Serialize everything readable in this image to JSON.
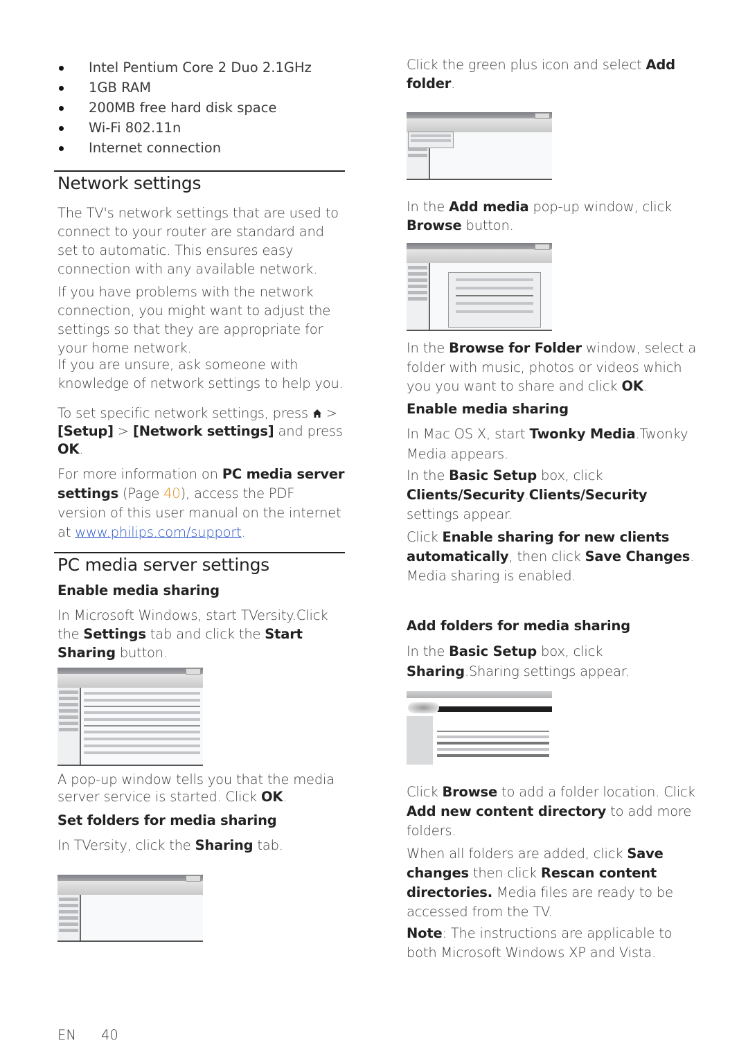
{
  "requirements": {
    "items": [
      "Intel Pentium Core 2 Duo 2.1GHz",
      "1GB RAM",
      "200MB free hard disk space",
      "Wi-Fi 802.11n",
      "Internet connection"
    ]
  },
  "network": {
    "title": "Network settings",
    "para1": "The TV's network settings that are used to connect to your router are standard and set to automatic. This ensures easy connection with any available network.",
    "para2": "If you have problems with the network connection, you might want to adjust the settings so that they are appropriate for your home network.",
    "para3": "If you are unsure, ask someone with knowledge of network settings to help you.",
    "para4_a": "To set specific network settings, press ",
    "para4_b": " > ",
    "para4_setup": "[Setup]",
    "para4_c": " > ",
    "para4_netset": "[Network settings]",
    "para4_d": " and press ",
    "para4_ok": "OK",
    "para4_e": ".",
    "para5_a": "For more information on ",
    "para5_bold": "PC media server settings",
    "para5_b": " (Page ",
    "para5_page": "40",
    "para5_c": "), access the PDF version of this user manual on the internet at ",
    "para5_link": "www.philips.com/support",
    "para5_d": "."
  },
  "pcms": {
    "title": "PC media server settings",
    "enable_heading": "Enable media sharing",
    "win_a": "In Microsoft Windows, start TVersity.Click the ",
    "win_settings": "Settings",
    "win_b": " tab and click the ",
    "win_start": "Start Sharing",
    "win_c": " button.",
    "popup_a": "A pop-up window tells you that the media server service is started. Click ",
    "popup_ok": "OK",
    "popup_b": ".",
    "set_folders_heading": "Set folders for media sharing",
    "tversity_a": "In TVersity, click the ",
    "tversity_sharing": "Sharing",
    "tversity_b": " tab."
  },
  "right": {
    "plus_a": "Click the green plus icon and select ",
    "plus_bold": "Add folder",
    "plus_b": ".",
    "addmedia_a": "In the ",
    "addmedia_bold": "Add media",
    "addmedia_b": " pop-up window, click ",
    "addmedia_browse": "Browse",
    "addmedia_c": " button.",
    "bff_a": "In the ",
    "bff_bold": "Browse for Folder",
    "bff_b": " window, select a folder with music, photos or videos which you you want to share and click ",
    "bff_ok": "OK",
    "bff_c": ".",
    "enable_heading": "Enable media sharing",
    "mac_a": "In Mac OS X, start ",
    "mac_bold": "Twonky Media",
    "mac_b": ".Twonky Media appears.",
    "basic_a": "In the ",
    "basic_bold": "Basic Setup",
    "basic_b": " box, click ",
    "basic_cs1": "Clients/Security",
    "basic_dot": ".",
    "basic_cs2": "Clients/Security",
    "basic_c": " settings appear.",
    "esnc_a": "Click ",
    "esnc_bold": "Enable sharing for new clients automatically",
    "esnc_b": ", then click ",
    "esnc_save": "Save Changes",
    "esnc_c": ". Media sharing is enabled.",
    "addfolders_heading": "Add folders for media sharing",
    "sharing_a": "In the ",
    "sharing_bold": "Basic Setup",
    "sharing_b": " box, click ",
    "sharing_sharing": "Sharing",
    "sharing_c": ".Sharing settings appear.",
    "browse_a": "Click ",
    "browse_bold": "Browse",
    "browse_b": " to add a folder location. Click ",
    "browse_add": "Add new content directory",
    "browse_c": " to add more folders.",
    "when_a": "When all folders are added, click ",
    "when_save": "Save changes",
    "when_b": " then click ",
    "when_rescan": "Rescan content directories.",
    "when_c": " Media files are ready to be accessed from the TV.",
    "note_bold": "Note",
    "note_text": ": The instructions are applicable to both Microsoft Windows XP and Vista."
  },
  "footer": {
    "lang": "EN",
    "page": "40"
  },
  "colors": {
    "link": "#2a55c8",
    "page_ref": "#e88a1a"
  }
}
